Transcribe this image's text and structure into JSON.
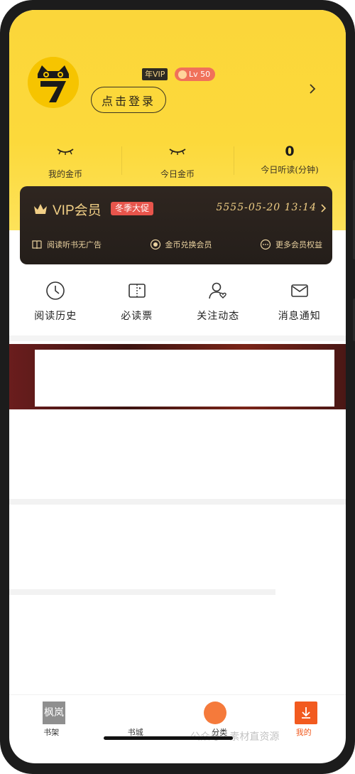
{
  "header": {
    "vip_tag": "年VIP",
    "level_tag": "Lv 50",
    "login_button": "点击登录"
  },
  "stats": [
    {
      "value": "",
      "label": "我的金币"
    },
    {
      "value": "",
      "label": "今日金币"
    },
    {
      "value": "0",
      "label": "今日听读(分钟)"
    }
  ],
  "vip_card": {
    "title": "VIP会员",
    "promo": "冬季大促",
    "expiry": "5555-05-20 13:14",
    "benefits": [
      "阅读听书无广告",
      "金币兑换会员",
      "更多会员权益"
    ]
  },
  "actions": [
    {
      "label": "阅读历史",
      "icon": "clock-icon"
    },
    {
      "label": "必读票",
      "icon": "ticket-icon"
    },
    {
      "label": "关注动态",
      "icon": "follow-user-icon"
    },
    {
      "label": "消息通知",
      "icon": "mail-icon"
    }
  ],
  "bottom_nav": [
    {
      "label": "书架",
      "thumb_text": "枫岚"
    },
    {
      "label": "书城"
    },
    {
      "label": "分类"
    },
    {
      "label": "我的",
      "active": true
    }
  ],
  "watermark": "公众号 · 素材直资源",
  "colors": {
    "header_yellow": "#fcd93b",
    "vip_gold": "#f1cf86",
    "promo_red": "#e8554c",
    "accent_orange": "#f0581c"
  }
}
